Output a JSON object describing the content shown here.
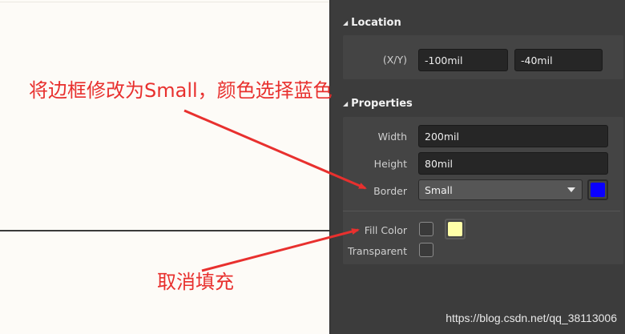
{
  "location": {
    "section_title": "Location",
    "xy_label": "(X/Y)",
    "x_value": "-100mil",
    "y_value": "-40mil"
  },
  "properties": {
    "section_title": "Properties",
    "width_label": "Width",
    "width_value": "200mil",
    "height_label": "Height",
    "height_value": "80mil",
    "border_label": "Border",
    "border_value": "Small",
    "border_color": "#0a00ff",
    "fill_label": "Fill Color",
    "fill_color": "#ffffa8",
    "fill_checked": false,
    "transparent_label": "Transparent",
    "transparent_checked": false
  },
  "annotations": {
    "top": "将边框修改为Small，颜色选择蓝色",
    "bottom": "取消填充",
    "color": "#e8302e"
  },
  "watermark": "https://blog.csdn.net/qq_38113006"
}
